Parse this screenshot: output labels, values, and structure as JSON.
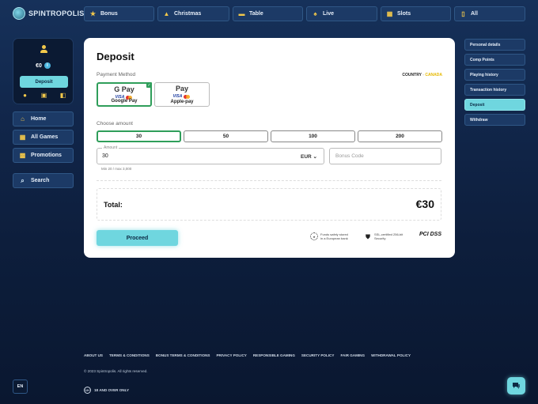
{
  "brand": {
    "name": "SPINTROPOLIS"
  },
  "nav": {
    "tabs": [
      {
        "label": "Bonus",
        "icon": "star-icon"
      },
      {
        "label": "Christmas",
        "icon": "tree-icon"
      },
      {
        "label": "Table",
        "icon": "table-icon"
      },
      {
        "label": "Live",
        "icon": "dealer-icon"
      },
      {
        "label": "Slots",
        "icon": "slot-icon"
      },
      {
        "label": "All",
        "icon": "cards-icon"
      }
    ]
  },
  "account": {
    "balance": "€0",
    "info": "i",
    "deposit_label": "Deposit"
  },
  "sidebar": {
    "items": [
      {
        "label": "Home",
        "icon": "home-icon"
      },
      {
        "label": "All Games",
        "icon": "games-icon"
      },
      {
        "label": "Promotions",
        "icon": "gift-icon"
      }
    ],
    "search_label": "Search"
  },
  "deposit": {
    "title": "Deposit",
    "payment_method_label": "Payment Method",
    "country_label": "COUNTRY",
    "country_sep": " - ",
    "country_value": "CANADA",
    "methods": [
      {
        "mark": "G Pay",
        "name": "Google Pay",
        "selected": true
      },
      {
        "mark": " Pay",
        "name": "Apple-pay",
        "selected": false
      }
    ],
    "visa": "VISA",
    "choose_amount_label": "Choose amount",
    "amounts": [
      "30",
      "50",
      "100",
      "200"
    ],
    "amount_field_label": "Amount",
    "amount_value": "30",
    "currency": "EUR",
    "bonus_placeholder": "Bonus Code",
    "minmax": "Min 20 / max 3,000",
    "total_label": "Total:",
    "total_value": "€30",
    "proceed_label": "Proceed",
    "trust": [
      {
        "line1": "Funds safely stored",
        "line2": "in a European bank"
      },
      {
        "line1": "SSL-certified 256-bit",
        "line2": "Security"
      }
    ],
    "pci": "PCI DSS"
  },
  "account_menu": {
    "items": [
      {
        "label": "Personal details",
        "active": false
      },
      {
        "label": "Comp Points",
        "active": false
      },
      {
        "label": "Playing history",
        "active": false
      },
      {
        "label": "Transaction history",
        "active": false
      },
      {
        "label": "Deposit",
        "active": true
      },
      {
        "label": "Withdraw",
        "active": false
      }
    ]
  },
  "footer": {
    "links": [
      "ABOUT US",
      "TERMS & CONDITIONS",
      "BONUS TERMS & CONDITIONS",
      "PRIVACY POLICY",
      "RESPONSIBLE GAMING",
      "SECURITY POLICY",
      "FAIR GAMING",
      "WITHDRAWAL POLICY"
    ],
    "copyright": "© 2023 Spintropolis. All rights reserved.",
    "age_badge": "18+",
    "age_text": "18 AND OVER ONLY",
    "language": "EN"
  },
  "colors": {
    "accent": "#6fd6df",
    "selected_border": "#2f9e5a",
    "country_highlight": "#e6b800",
    "background": "#11264a"
  }
}
